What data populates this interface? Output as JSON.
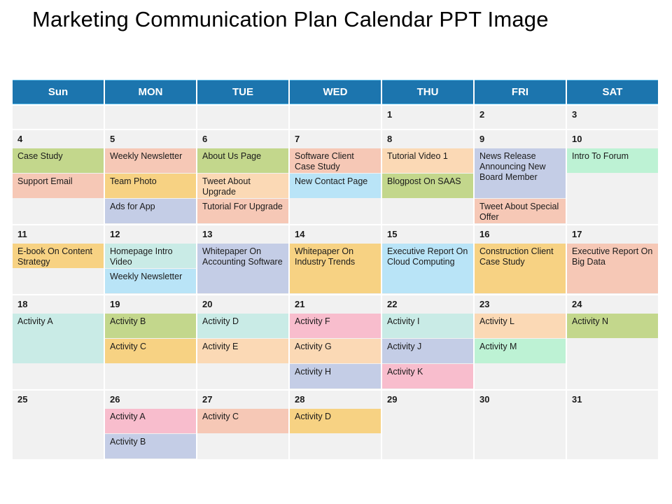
{
  "title": "Marketing Communication Plan Calendar PPT Image",
  "header": {
    "accent_color": "#1c75ae",
    "weekdays": [
      "Sun",
      "MON",
      "TUE",
      "WED",
      "THU",
      "FRI",
      "SAT"
    ]
  },
  "palette": {
    "olive_green": "#c3d78c",
    "salmon": "#f6c8b6",
    "peach": "#fbd9b5",
    "amber": "#f7d283",
    "periwinkle": "#c4cde6",
    "sky_blue": "#b9e4f7",
    "pale_cyan": "#c9ebe6",
    "mint_green": "#bdf2d4",
    "pink": "#f8bdcd",
    "lavender": "#c9cde8",
    "cell_empty": "#f1f1f1"
  },
  "weeks": [
    {
      "id": "week-1",
      "days": [
        {
          "num": "",
          "events": []
        },
        {
          "num": "",
          "events": []
        },
        {
          "num": "",
          "events": []
        },
        {
          "num": "",
          "events": []
        },
        {
          "num": "1",
          "events": []
        },
        {
          "num": "2",
          "events": []
        },
        {
          "num": "3",
          "events": []
        }
      ]
    },
    {
      "id": "week-2",
      "days": [
        {
          "num": "4",
          "events": [
            {
              "label": "Case Study",
              "color": "#c3d78c",
              "span": 1
            },
            {
              "label": "Support Email",
              "color": "#f6c8b6",
              "span": 1
            }
          ]
        },
        {
          "num": "5",
          "events": [
            {
              "label": "Weekly Newsletter",
              "color": "#f6c8b6",
              "span": 1
            },
            {
              "label": "Team Photo",
              "color": "#f7d283",
              "span": 1
            },
            {
              "label": "Ads for App",
              "color": "#c4cde6",
              "span": 1
            }
          ]
        },
        {
          "num": "6",
          "events": [
            {
              "label": "About Us Page",
              "color": "#c3d78c",
              "span": 1
            },
            {
              "label": "Tweet About Upgrade",
              "color": "#fbd9b5",
              "span": 1
            },
            {
              "label": "Tutorial For Upgrade",
              "color": "#f6c8b6",
              "span": 1
            }
          ]
        },
        {
          "num": "7",
          "events": [
            {
              "label": "Software Client Case Study",
              "color": "#f6c8b6",
              "span": 1
            },
            {
              "label": "New Contact Page",
              "color": "#b9e4f7",
              "span": 1
            }
          ]
        },
        {
          "num": "8",
          "events": [
            {
              "label": "Tutorial Video 1",
              "color": "#fbd9b5",
              "span": 1
            },
            {
              "label": "Blogpost On SAAS",
              "color": "#c3d78c",
              "span": 1
            }
          ]
        },
        {
          "num": "9",
          "events": [
            {
              "label": "News Release Announcing New Board Member",
              "color": "#c4cde6",
              "span": 2
            },
            {
              "label": "Tweet About Special Offer",
              "color": "#f6c8b6",
              "span": 1
            }
          ]
        },
        {
          "num": "10",
          "events": [
            {
              "label": "Intro To Forum",
              "color": "#bdf2d4",
              "span": 1
            }
          ]
        }
      ]
    },
    {
      "id": "week-3",
      "days": [
        {
          "num": "11",
          "events": [
            {
              "label": "E-book On Content Strategy",
              "color": "#f7d283",
              "span": 1
            }
          ]
        },
        {
          "num": "12",
          "events": [
            {
              "label": "Homepage Intro Video",
              "color": "#c9ebe6",
              "span": 1
            },
            {
              "label": "Weekly Newsletter",
              "color": "#b9e4f7",
              "span": 1
            }
          ]
        },
        {
          "num": "13",
          "events": [
            {
              "label": "Whitepaper On Accounting Software",
              "color": "#c4cde6",
              "span": 2
            }
          ]
        },
        {
          "num": "14",
          "events": [
            {
              "label": "Whitepaper On Industry Trends",
              "color": "#f7d283",
              "span": 2
            }
          ]
        },
        {
          "num": "15",
          "events": [
            {
              "label": "Executive Report On Cloud Computing",
              "color": "#b9e4f7",
              "span": 2
            }
          ]
        },
        {
          "num": "16",
          "events": [
            {
              "label": "Construction Client Case Study",
              "color": "#f7d283",
              "span": 2
            }
          ]
        },
        {
          "num": "17",
          "events": [
            {
              "label": "Executive Report On Big Data",
              "color": "#f6c8b6",
              "span": 2
            }
          ]
        }
      ]
    },
    {
      "id": "week-4",
      "days": [
        {
          "num": "18",
          "events": [
            {
              "label": "Activity A",
              "color": "#c9ebe6",
              "span": 2
            }
          ]
        },
        {
          "num": "19",
          "events": [
            {
              "label": "Activity B",
              "color": "#c3d78c",
              "span": 1
            },
            {
              "label": "Activity C",
              "color": "#f7d283",
              "span": 1
            }
          ]
        },
        {
          "num": "20",
          "events": [
            {
              "label": "Activity D",
              "color": "#c9ebe6",
              "span": 1
            },
            {
              "label": "Activity E",
              "color": "#fbd9b5",
              "span": 1
            }
          ]
        },
        {
          "num": "21",
          "events": [
            {
              "label": "Activity F",
              "color": "#f8bdcd",
              "span": 1
            },
            {
              "label": "Activity G",
              "color": "#fbd9b5",
              "span": 1
            },
            {
              "label": "Activity H",
              "color": "#c4cde6",
              "span": 1
            }
          ]
        },
        {
          "num": "22",
          "events": [
            {
              "label": "Activity I",
              "color": "#c9ebe6",
              "span": 1
            },
            {
              "label": "Activity J",
              "color": "#c4cde6",
              "span": 1
            },
            {
              "label": "Activity K",
              "color": "#f8bdcd",
              "span": 1
            }
          ]
        },
        {
          "num": "23",
          "events": [
            {
              "label": "Activity L",
              "color": "#fbd9b5",
              "span": 1
            },
            {
              "label": "Activity M",
              "color": "#bdf2d4",
              "span": 1
            }
          ]
        },
        {
          "num": "24",
          "events": [
            {
              "label": "Activity N",
              "color": "#c3d78c",
              "span": 1
            }
          ]
        }
      ]
    },
    {
      "id": "week-5",
      "days": [
        {
          "num": "25",
          "events": []
        },
        {
          "num": "26",
          "events": [
            {
              "label": "Activity A",
              "color": "#f8bdcd",
              "span": 1
            },
            {
              "label": "Activity B",
              "color": "#c4cde6",
              "span": 1
            }
          ]
        },
        {
          "num": "27",
          "events": [
            {
              "label": "Activity C",
              "color": "#f6c8b6",
              "span": 1
            }
          ]
        },
        {
          "num": "28",
          "events": [
            {
              "label": "Activity D",
              "color": "#f7d283",
              "span": 1
            }
          ]
        },
        {
          "num": "29",
          "events": []
        },
        {
          "num": "30",
          "events": []
        },
        {
          "num": "31",
          "events": []
        }
      ]
    }
  ]
}
